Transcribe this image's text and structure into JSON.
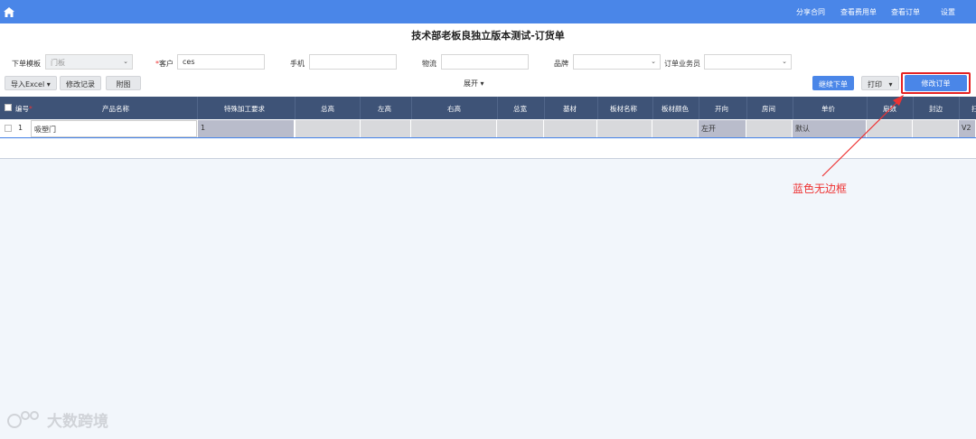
{
  "topnav": {
    "items": [
      "分享合同",
      "查看费用单",
      "查看订单",
      "设置"
    ]
  },
  "page": {
    "title": "技术部老板良独立版本测试-订货单"
  },
  "form": {
    "template_label": "下单模板",
    "template_value": "门板",
    "customer_label": "客户",
    "customer_required": "*",
    "customer_value": "ces",
    "phone_label": "手机",
    "phone_value": "",
    "logistics_label": "物流",
    "logistics_value": "",
    "brand_label": "品牌",
    "brand_value": "",
    "salesman_label": "订单业务员",
    "salesman_value": ""
  },
  "toolbar": {
    "import_excel": "导入Excel",
    "modify_records": "修改记录",
    "attachment": "附图",
    "expand": "展开",
    "continue_order": "继续下单",
    "print": "打印",
    "modify_order": "修改订单"
  },
  "table": {
    "headers": [
      "编号",
      "产品名称",
      "特殊加工要求",
      "总高",
      "左高",
      "右高",
      "总宽",
      "基材",
      "板材名称",
      "板材颜色",
      "开向",
      "房间",
      "单价",
      "扇数",
      "封边",
      "扫"
    ],
    "rows": [
      {
        "no": "1",
        "product": "吸塑门",
        "special": "1",
        "total_h": "",
        "left_h": "",
        "right_h": "",
        "total_w": "",
        "base": "",
        "board_name": "",
        "board_color": "",
        "open_dir": "左开",
        "room": "",
        "price": "默认",
        "leaves": "",
        "edge": "",
        "last": "V2"
      }
    ]
  },
  "annotation": {
    "text": "蓝色无边框"
  },
  "watermark": {
    "text": "大数跨境"
  },
  "colors": {
    "topbar": "#4a86e8",
    "table_header": "#3e5377",
    "annotation": "#e33333"
  }
}
